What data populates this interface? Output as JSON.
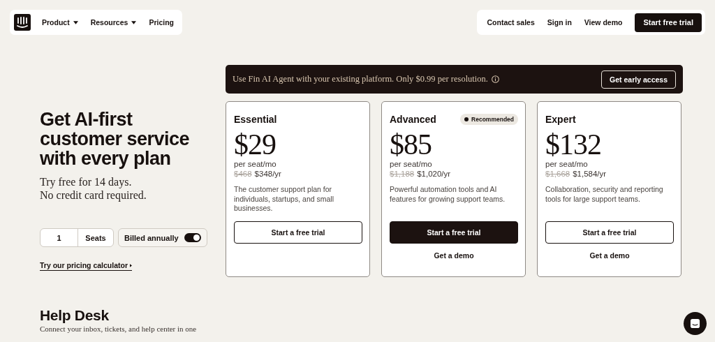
{
  "nav": {
    "left": [
      {
        "label": "Product",
        "dropdown": true
      },
      {
        "label": "Resources",
        "dropdown": true
      },
      {
        "label": "Pricing",
        "dropdown": false
      }
    ],
    "right": [
      {
        "label": "Contact sales",
        "kind": "link"
      },
      {
        "label": "Sign in",
        "kind": "link"
      },
      {
        "label": "View demo",
        "kind": "link"
      },
      {
        "label": "Start free trial",
        "kind": "primary"
      }
    ]
  },
  "hero": {
    "title": "Get AI-first customer service with every plan",
    "subtitle_lines": [
      "Try free for 14 days.",
      "No credit card required."
    ],
    "seats": {
      "value": "1",
      "label": "Seats"
    },
    "billing": {
      "label": "Billed annually",
      "on": true
    },
    "calculator_link": "Try our pricing calculator"
  },
  "promo": {
    "text": "Use Fin AI Agent with your existing platform. Only $0.99 per resolution.",
    "button": "Get early access"
  },
  "plans": [
    {
      "name": "Essential",
      "price": "$29",
      "unit": "per seat/mo",
      "old_price": "$468",
      "yearly": "$348/yr",
      "description": "The customer support plan for individuals, startups, and small businesses.",
      "trial": "Start a free trial",
      "primary": false
    },
    {
      "name": "Advanced",
      "badge": "Recommended",
      "price": "$85",
      "unit": "per seat/mo",
      "old_price": "$1,188",
      "yearly": "$1,020/yr",
      "description": "Powerful automation tools and AI features for growing support teams.",
      "trial": "Start a free trial",
      "primary": true,
      "demo": "Get a demo"
    },
    {
      "name": "Expert",
      "price": "$132",
      "unit": "per seat/mo",
      "old_price": "$1,668",
      "yearly": "$1,584/yr",
      "description": "Collaboration, security and reporting tools for large support teams.",
      "trial": "Start a free trial",
      "primary": false,
      "demo": "Get a demo"
    }
  ],
  "section": {
    "title": "Help Desk",
    "text": "Connect your inbox, tickets, and help center in one"
  }
}
